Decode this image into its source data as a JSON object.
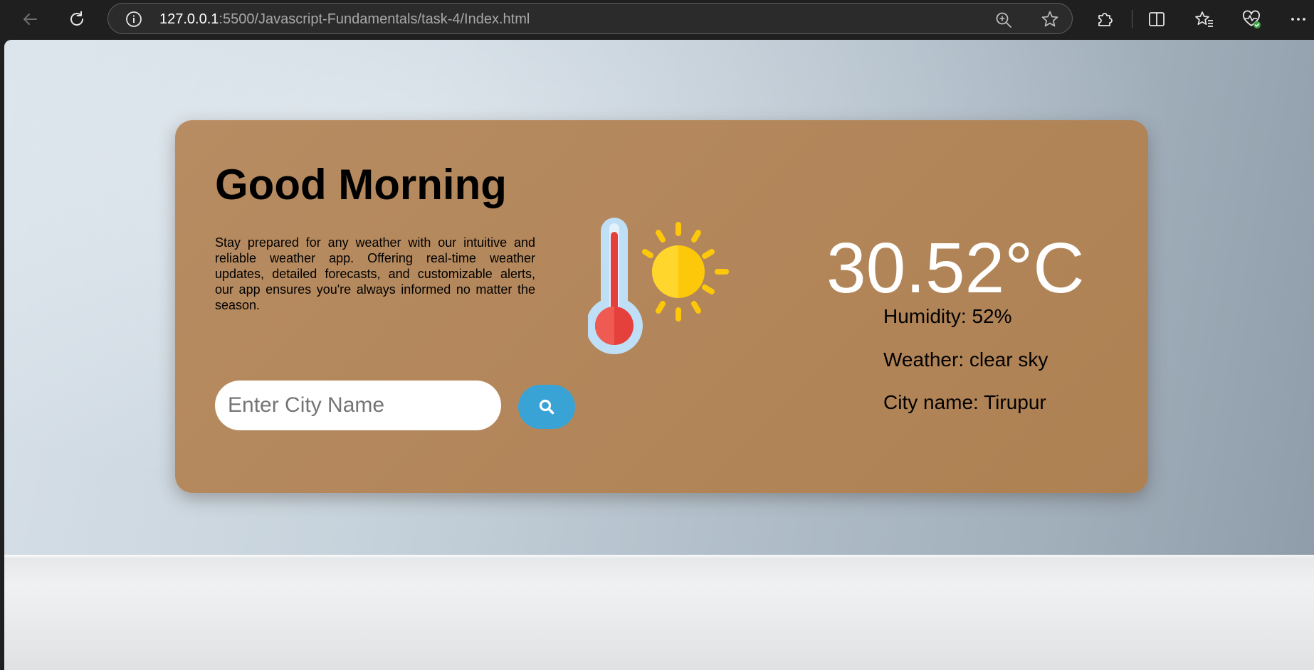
{
  "browser": {
    "url_host": "127.0.0.1",
    "url_rest": ":5500/Javascript-Fundamentals/task-4/Index.html",
    "icons": {
      "back": "back-arrow-icon",
      "refresh": "refresh-icon",
      "site_info": "info-icon",
      "zoom": "zoom-in-icon",
      "favorite": "star-icon",
      "extensions": "puzzle-icon",
      "split_screen": "split-screen-icon",
      "favorites_bar": "favorites-icon",
      "browser_essentials": "heart-pulse-icon",
      "menu": "more-icon"
    }
  },
  "weather_card": {
    "greeting": "Good Morning",
    "description": "Stay prepared for any weather with our intuitive and reliable weather app. Offering real-time weather updates, detailed forecasts, and customizable alerts, our app ensures you're always informed no matter the season.",
    "search": {
      "placeholder": "Enter City Name",
      "value": "",
      "button_icon": "search-icon"
    },
    "illustration": "thermometer-sun-icon",
    "temperature": "30.52°C",
    "humidity": "Humidity: 52%",
    "weather": "Weather: clear sky",
    "city": "City name: Tirupur"
  },
  "colors": {
    "card": "#b3875b",
    "search_button": "#3aa3d5",
    "temperature_text": "#ffffff"
  }
}
